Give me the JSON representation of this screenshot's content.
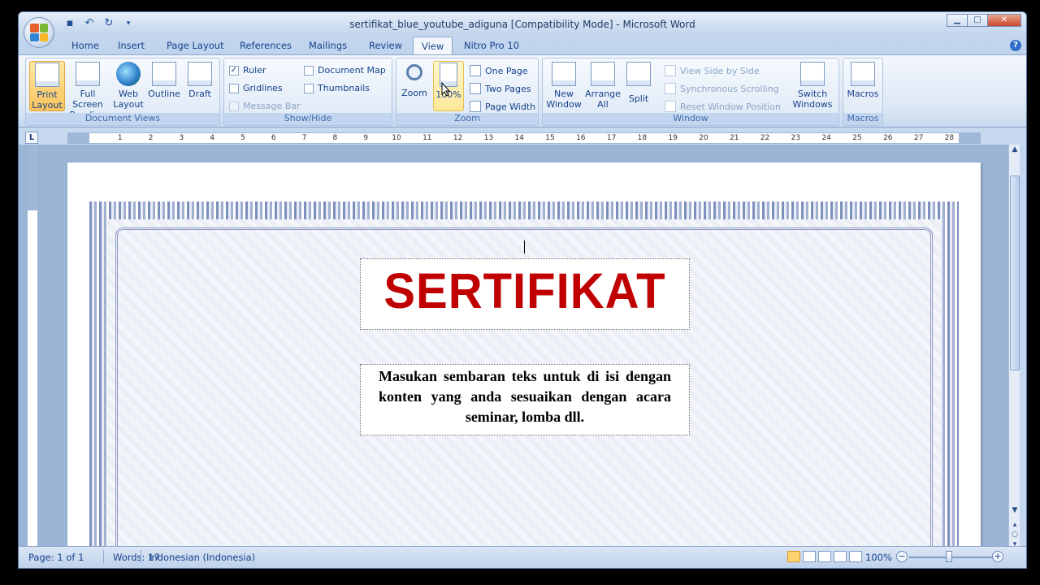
{
  "window": {
    "title": "sertifikat_blue_youtube_adiguna [Compatibility Mode] - Microsoft Word",
    "controls": {
      "minimize": "▁",
      "maximize": "□",
      "close": "✕"
    }
  },
  "tabs": [
    "Home",
    "Insert",
    "Page Layout",
    "References",
    "Mailings",
    "Review",
    "View",
    "Nitro Pro 10"
  ],
  "active_tab": "View",
  "ribbon": {
    "document_views": {
      "label": "Document Views",
      "print_layout": "Print Layout",
      "full_screen_reading": "Full Screen Reading",
      "web_layout": "Web Layout",
      "outline": "Outline",
      "draft": "Draft"
    },
    "show_hide": {
      "label": "Show/Hide",
      "ruler": "Ruler",
      "gridlines": "Gridlines",
      "message_bar": "Message Bar",
      "document_map": "Document Map",
      "thumbnails": "Thumbnails",
      "ruler_checked": "✓"
    },
    "zoom": {
      "label": "Zoom",
      "zoom": "Zoom",
      "hundred": "100%",
      "one_page": "One Page",
      "two_pages": "Two Pages",
      "page_width": "Page Width"
    },
    "window": {
      "label": "Window",
      "new_window": "New Window",
      "arrange_all": "Arrange All",
      "split": "Split",
      "view_side_by_side": "View Side by Side",
      "synchronous_scrolling": "Synchronous Scrolling",
      "reset_window_position": "Reset Window Position",
      "switch_windows": "Switch Windows"
    },
    "macros": {
      "label": "Macros",
      "macros": "Macros"
    }
  },
  "ruler": {
    "corner": "L",
    "numbers": [
      "1",
      "2",
      "3",
      "4",
      "5",
      "6",
      "7",
      "8",
      "9",
      "10",
      "11",
      "12",
      "13",
      "14",
      "15",
      "16",
      "17",
      "18",
      "19",
      "20",
      "21",
      "22",
      "23",
      "24",
      "25",
      "26",
      "27",
      "28"
    ]
  },
  "document": {
    "title": "SERTIFIKAT",
    "body": "Masukan sembaran teks untuk di isi dengan konten yang anda sesuaikan dengan acara seminar, lomba dll."
  },
  "status": {
    "page": "Page: 1 of 1",
    "words": "Words: 17",
    "language": "Indonesian (Indonesia)",
    "zoom": "100%"
  }
}
